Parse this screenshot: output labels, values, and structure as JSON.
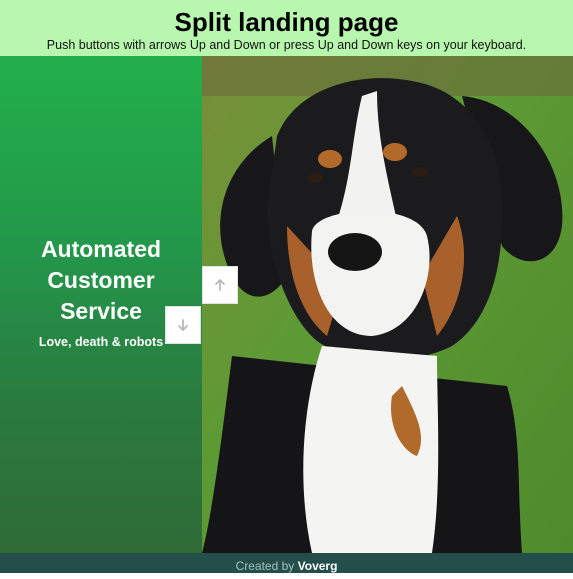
{
  "header": {
    "title": "Split landing page",
    "subtitle": "Push buttons with arrows Up and Down or press Up and Down keys on your keyboard."
  },
  "left_panel": {
    "heading_lines": [
      "Automated",
      "Customer",
      "Service"
    ],
    "tagline": "Love, death & robots"
  },
  "nav": {
    "up_icon": "arrow-up-icon",
    "down_icon": "arrow-down-icon"
  },
  "photo": {
    "subject": "dog-photo"
  },
  "footer": {
    "prefix": "Created by",
    "author": "Voverg"
  },
  "colors": {
    "header_bg": "#b7f7ae",
    "panel_green": "#23a24a",
    "footer_bg": "#244e4a"
  }
}
